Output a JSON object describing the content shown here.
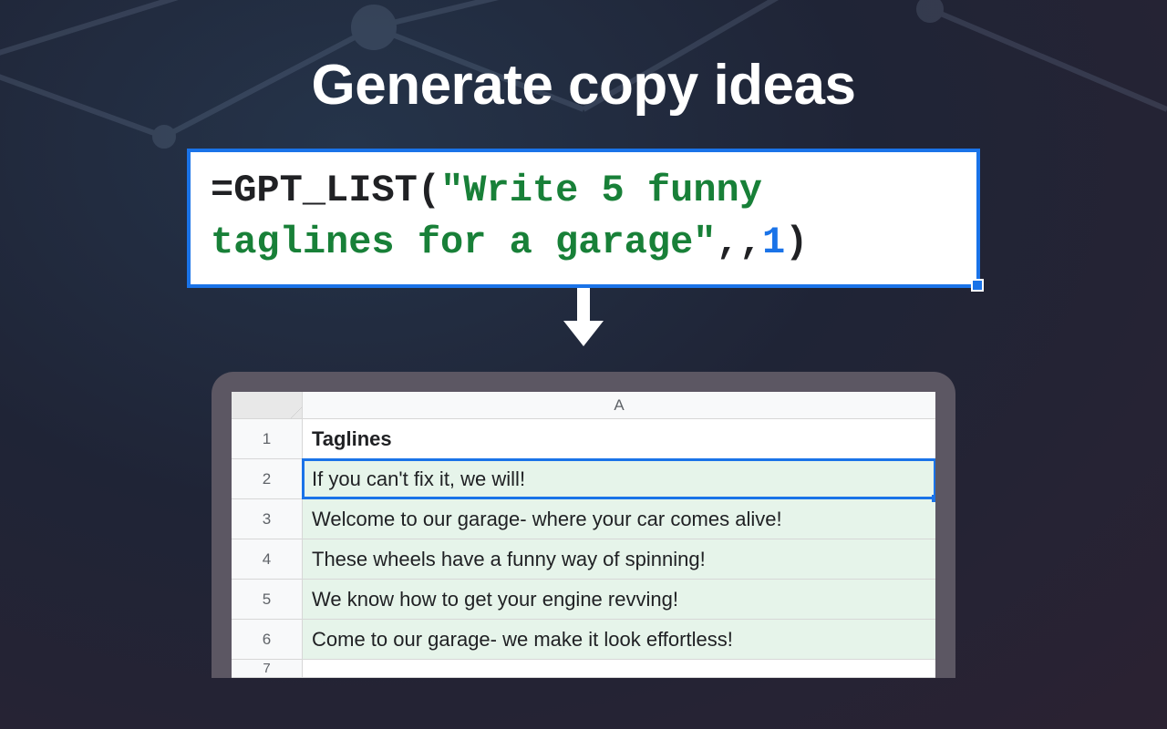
{
  "title": "Generate copy ideas",
  "formula": {
    "prefix_eq": "=",
    "function_name": "GPT_LIST",
    "open_paren": "(",
    "string_arg_q1": "\"",
    "string_arg_line1": "Write 5 funny",
    "string_arg_line2": "taglines for a garage",
    "string_arg_q2": "\"",
    "commas": ",,",
    "num_arg": "1",
    "close_paren": ")"
  },
  "sheet": {
    "column_letter": "A",
    "rows": [
      {
        "num": "1",
        "text": "Taglines",
        "bold": true,
        "highlight": false,
        "selected": false
      },
      {
        "num": "2",
        "text": "If you can't fix it, we will!",
        "bold": false,
        "highlight": true,
        "selected": true
      },
      {
        "num": "3",
        "text": "Welcome to our garage- where your car comes alive!",
        "bold": false,
        "highlight": true,
        "selected": false
      },
      {
        "num": "4",
        "text": "These wheels have a funny way of spinning!",
        "bold": false,
        "highlight": true,
        "selected": false
      },
      {
        "num": "5",
        "text": "We know how to get your engine revving!",
        "bold": false,
        "highlight": true,
        "selected": false
      },
      {
        "num": "6",
        "text": "Come to our garage- we make it look effortless!",
        "bold": false,
        "highlight": true,
        "selected": false
      },
      {
        "num": "7",
        "text": "",
        "bold": false,
        "highlight": false,
        "selected": false
      }
    ]
  }
}
